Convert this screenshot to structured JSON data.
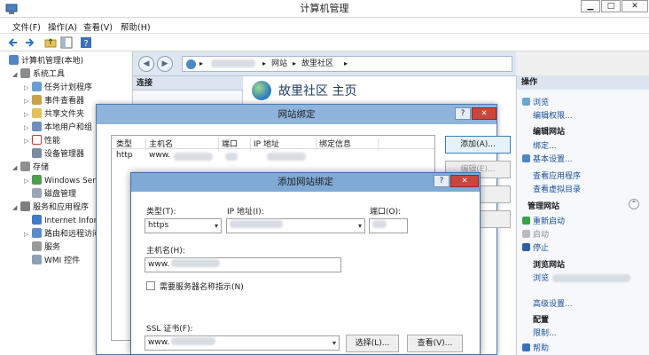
{
  "window": {
    "title": "计算机管理"
  },
  "menu": [
    "文件(F)",
    "操作(A)",
    "查看(V)",
    "帮助(H)"
  ],
  "tree": [
    {
      "label": "计算机管理(本地)",
      "depth": 0,
      "twisty": ""
    },
    {
      "label": "系统工具",
      "depth": 1,
      "twisty": "◢"
    },
    {
      "label": "任务计划程序",
      "depth": 2,
      "twisty": "▷"
    },
    {
      "label": "事件查看器",
      "depth": 2,
      "twisty": "▷"
    },
    {
      "label": "共享文件夹",
      "depth": 2,
      "twisty": "▷"
    },
    {
      "label": "本地用户和组",
      "depth": 2,
      "twisty": "▷"
    },
    {
      "label": "性能",
      "depth": 2,
      "twisty": "▷"
    },
    {
      "label": "设备管理器",
      "depth": 2,
      "twisty": ""
    },
    {
      "label": "存储",
      "depth": 1,
      "twisty": "◢"
    },
    {
      "label": "Windows Ser",
      "depth": 2,
      "twisty": "▷"
    },
    {
      "label": "磁盘管理",
      "depth": 2,
      "twisty": ""
    },
    {
      "label": "服务和应用程序",
      "depth": 1,
      "twisty": "◢"
    },
    {
      "label": "Internet Infor",
      "depth": 2,
      "twisty": ""
    },
    {
      "label": "路由和远程访问",
      "depth": 2,
      "twisty": "▷"
    },
    {
      "label": "服务",
      "depth": 2,
      "twisty": ""
    },
    {
      "label": "WMI 控件",
      "depth": 2,
      "twisty": ""
    }
  ],
  "iis": {
    "address": [
      "网站",
      "故里社区"
    ],
    "connections_header": "连接",
    "home_title": "故里社区 主页"
  },
  "actions": {
    "header": "操作",
    "browse": "浏览",
    "edit_perms": "编辑权限...",
    "edit_site_header": "编辑网站",
    "bindings": "绑定...",
    "basic_settings": "基本设置...",
    "view_apps": "查看应用程序",
    "view_vdirs": "查看虚拟目录",
    "manage_site_header": "管理网站",
    "restart": "重新启动",
    "start": "启动",
    "stop": "停止",
    "browse_site_header": "浏览网站",
    "browse2": "浏览",
    "advanced": "高级设置...",
    "config_header": "配置",
    "limits": "限制...",
    "help": "帮助"
  },
  "site_bindings": {
    "title": "网站绑定",
    "columns": [
      "类型",
      "主机名",
      "端口",
      "IP 地址",
      "绑定信息"
    ],
    "rows": [
      {
        "type": "http",
        "host": "www."
      }
    ],
    "add_button": "添加(A)...",
    "edit_button": "编辑(E)..."
  },
  "add_binding": {
    "title": "添加网站绑定",
    "type_label": "类型(T):",
    "type_value": "https",
    "ip_label": "IP 地址(I):",
    "port_label": "端口(O):",
    "host_label": "主机名(H):",
    "host_value": "www.",
    "sni_label": "需要服务器名称指示(N)",
    "ssl_label": "SSL 证书(F):",
    "ssl_value": "www.",
    "select_button": "选择(L)...",
    "view_button": "查看(V)..."
  },
  "colors": {
    "dialog_frame": "#8fb4dc",
    "link": "#1a4f9c",
    "close": "#c9463d"
  }
}
